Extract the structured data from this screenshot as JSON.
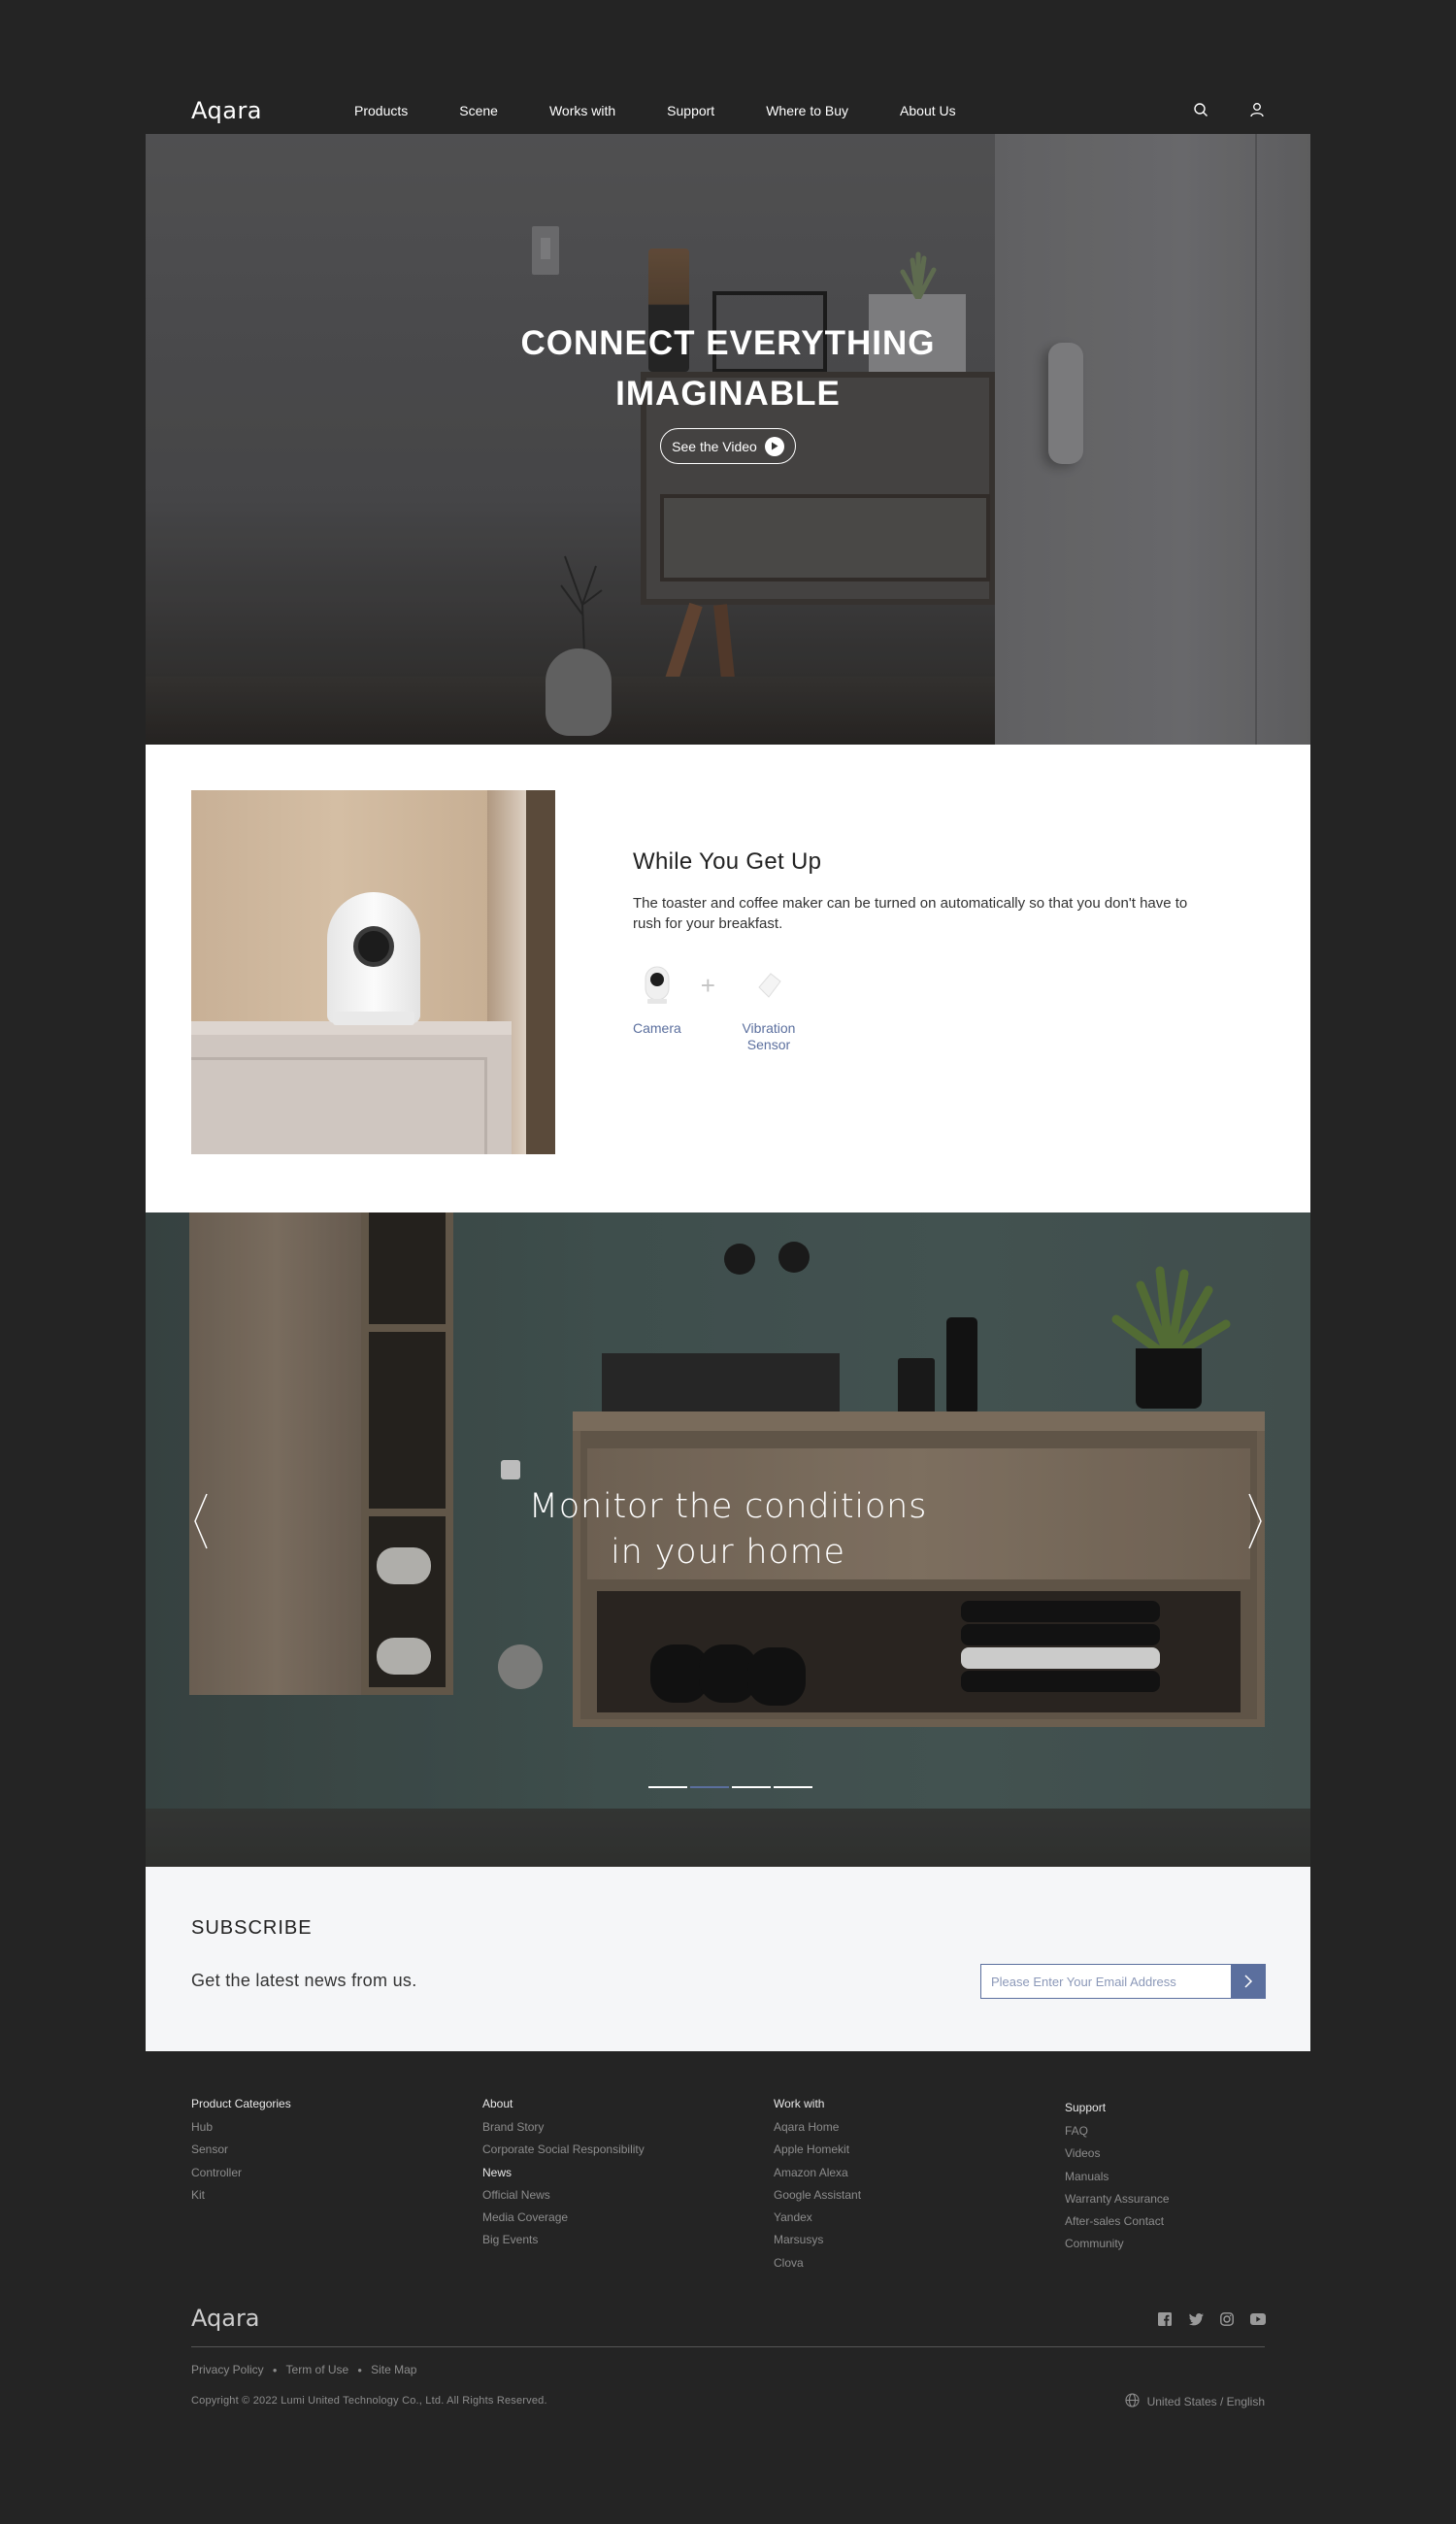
{
  "header": {
    "logo": "Aqara",
    "nav": [
      "Products",
      "Scene",
      "Works with",
      "Support",
      "Where to Buy",
      "About Us"
    ]
  },
  "hero": {
    "title_line1": "CONNECT EVERYTHING",
    "title_line2": "IMAGINABLE",
    "video_button": "See the Video"
  },
  "scene": {
    "title": "While You Get Up",
    "description": "The toaster and coffee maker can be turned on automatically so that you don't have to rush for your breakfast.",
    "devices": [
      "Camera",
      "Vibration Sensor"
    ],
    "plus": "+"
  },
  "carousel": {
    "title_line1": "Monitor the conditions",
    "title_line2": "in your home",
    "slide_count": 4,
    "active_slide": 2
  },
  "subscribe": {
    "title": "SUBSCRIBE",
    "description": "Get the latest news from us.",
    "placeholder": "Please Enter Your Email Address"
  },
  "footer": {
    "columns": [
      {
        "heading": "Product Categories",
        "links": [
          "Hub",
          "Sensor",
          "Controller",
          "Kit"
        ]
      },
      {
        "heading": "About",
        "links": [
          "Brand Story",
          "Corporate Social Responsibility"
        ],
        "subheading": "News",
        "sublinks": [
          "Official News",
          "Media Coverage",
          "Big Events"
        ]
      },
      {
        "heading": "Work with",
        "links": [
          "Aqara Home",
          "Apple Homekit",
          "Amazon Alexa",
          "Google Assistant",
          "Yandex",
          "Marsusys",
          "Clova"
        ]
      },
      {
        "heading": "Support",
        "links": [
          "FAQ",
          "Videos",
          "Manuals",
          "Warranty Assurance",
          "After-sales Contact",
          "Community"
        ]
      }
    ],
    "logo": "Aqara",
    "legal": [
      "Privacy Policy",
      "Term of Use",
      "Site Map"
    ],
    "copyright": "Copyright © 2022 Lumi United Technology Co., Ltd. All Rights Reserved.",
    "region": "United States / English",
    "social_icons": [
      "facebook-icon",
      "twitter-icon",
      "instagram-icon",
      "youtube-icon"
    ]
  },
  "colors": {
    "accent": "#5b6f9e",
    "page_bg": "#242424",
    "subscribe_bg": "#f5f6f8"
  }
}
